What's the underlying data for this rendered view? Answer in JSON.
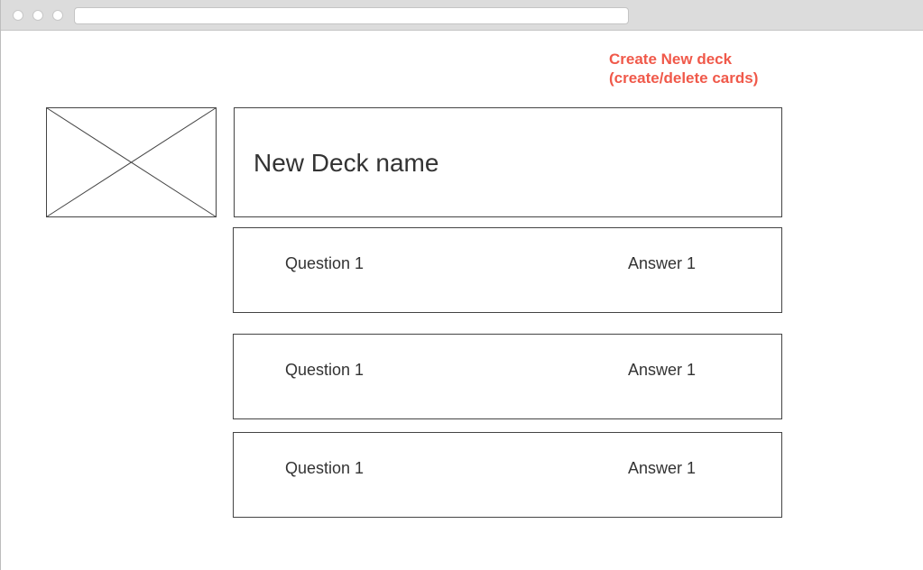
{
  "browser": {
    "url": ""
  },
  "annotation": {
    "line1": "Create New deck",
    "line2": "(create/delete cards)",
    "color": "#f0594a"
  },
  "deck": {
    "name": "New Deck name"
  },
  "cards": [
    {
      "question": "Question 1",
      "answer": "Answer 1"
    },
    {
      "question": "Question 1",
      "answer": "Answer 1"
    },
    {
      "question": "Question 1",
      "answer": "Answer 1"
    }
  ]
}
